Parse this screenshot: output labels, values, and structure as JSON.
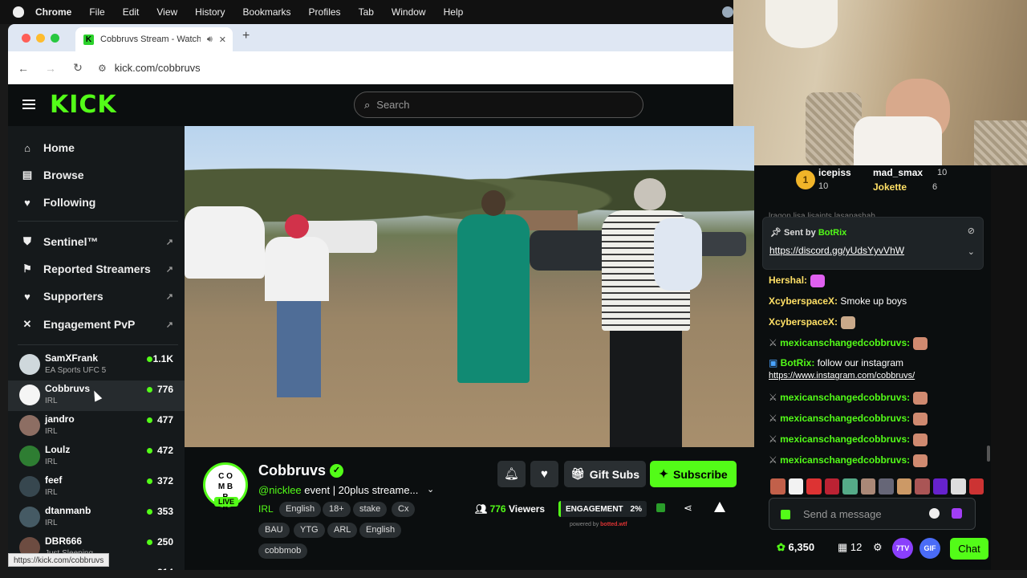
{
  "menubar": {
    "items": [
      "Chrome",
      "File",
      "Edit",
      "View",
      "History",
      "Bookmarks",
      "Profiles",
      "Tab",
      "Window",
      "Help"
    ]
  },
  "browser": {
    "tab_title": "Cobbruvs Stream - Watch",
    "new_tab": "+",
    "close": "✕",
    "url": "kick.com/cobbruvs",
    "status_url": "https://kick.com/cobbruvs"
  },
  "kick": {
    "logo": "KICK",
    "search_placeholder": "Search"
  },
  "sidebar": {
    "nav": [
      {
        "label": "Home",
        "icon": "home-icon",
        "glyph": "⌂"
      },
      {
        "label": "Browse",
        "icon": "browse-icon",
        "glyph": "▤"
      },
      {
        "label": "Following",
        "icon": "heart-icon",
        "glyph": "♥"
      }
    ],
    "mod": [
      {
        "label": "Sentinel™",
        "icon": "shield-icon",
        "glyph": "⛊"
      },
      {
        "label": "Reported Streamers",
        "icon": "flag-icon",
        "glyph": "⚑"
      },
      {
        "label": "Supporters",
        "icon": "heart-icon",
        "glyph": "♥"
      },
      {
        "label": "Engagement PvP",
        "icon": "swords-icon",
        "glyph": "✕"
      }
    ],
    "channels": [
      {
        "name": "SamXFrank",
        "category": "EA Sports UFC 5",
        "viewers": "1.1K",
        "color": "#cfd8dc"
      },
      {
        "name": "Cobbruvs",
        "category": "IRL",
        "viewers": "776",
        "color": "#f5f5f5"
      },
      {
        "name": "jandro",
        "category": "IRL",
        "viewers": "477",
        "color": "#8d6e63"
      },
      {
        "name": "Loulz",
        "category": "IRL",
        "viewers": "472",
        "color": "#2e7d32"
      },
      {
        "name": "feef",
        "category": "IRL",
        "viewers": "372",
        "color": "#37474f"
      },
      {
        "name": "dtanmanb",
        "category": "IRL",
        "viewers": "353",
        "color": "#455a64"
      },
      {
        "name": "DBR666",
        "category": "Just Sleeping",
        "viewers": "250",
        "color": "#6d4c41"
      }
    ],
    "partial_count": "214"
  },
  "stream": {
    "streamer": "Cobbruvs",
    "avatar_text": "C O\nM B\nB\nR",
    "live": "LIVE",
    "mention": "@nicklee",
    "title": " event | 20plus streame...",
    "category": "IRL",
    "tags": [
      "English",
      "18+",
      "stake",
      "Cx",
      "BAU",
      "YTG",
      "ARL",
      "English",
      "cobbmob"
    ],
    "gift_subs": "Gift Subs",
    "subscribe": "Subscribe",
    "viewers": "776",
    "viewers_label": " Viewers",
    "engagement_label": "ENGAGEMENT",
    "engagement_value": "2%",
    "powered_prefix": "powered by ",
    "powered_brand": "botted.wtf"
  },
  "chat": {
    "leaderboard": {
      "rank": "1",
      "top": {
        "name": "icepiss",
        "count": "10"
      },
      "second": {
        "name": "mad_smax",
        "count": "10"
      },
      "third": {
        "name": "Jokette",
        "count": "6"
      }
    },
    "prev_msg": "lraqon lisa lisaints lasanashab",
    "pinned": {
      "sent_by": "Sent by ",
      "bot": "BotRix",
      "link": "https://discord.gg/yUdsYyvVhW"
    },
    "messages": [
      {
        "user": "Hershal:",
        "text": "",
        "color": "#ffe066",
        "emote": "#e060f0"
      },
      {
        "user": "XcyberspaceX:",
        "text": " Smoke up boys",
        "color": "#ffe066",
        "emote": ""
      },
      {
        "user": "XcyberspaceX:",
        "text": "",
        "color": "#ffe066",
        "emote": "#c9a98a"
      },
      {
        "user": "mexicanschangedcobbruvs:",
        "text": "",
        "color": "#53fc18",
        "emote": "#d08a70"
      },
      {
        "user": "BotRix:",
        "text": " follow our instagram",
        "color": "#53fc18",
        "emote": ""
      },
      {
        "user": "mexicanschangedcobbruvs:",
        "text": "",
        "color": "#53fc18",
        "emote": "#d08a70"
      },
      {
        "user": "mexicanschangedcobbruvs:",
        "text": "",
        "color": "#53fc18",
        "emote": "#d08a70"
      },
      {
        "user": "mexicanschangedcobbruvs:",
        "text": "",
        "color": "#53fc18",
        "emote": "#d08a70"
      },
      {
        "user": "mexicanschangedcobbruvs:",
        "text": "",
        "color": "#53fc18",
        "emote": "#d08a70"
      }
    ],
    "instagram_link": "https://www.instagram.com/cobbruvs/",
    "emote_colors": [
      "#c2604a",
      "#f2f2f2",
      "#d33",
      "#b23",
      "#5a8",
      "#a87",
      "#667",
      "#c96",
      "#a55",
      "#62c",
      "#ddd",
      "#c33"
    ],
    "input_placeholder": "Send a message",
    "points": "6,350",
    "sub_count": "12",
    "pill_7tv": "7TV",
    "pill_gif": "GIF",
    "chat_button": "Chat"
  },
  "colors": {
    "accent": "#53fc18",
    "bg": "#0b0e0f"
  }
}
